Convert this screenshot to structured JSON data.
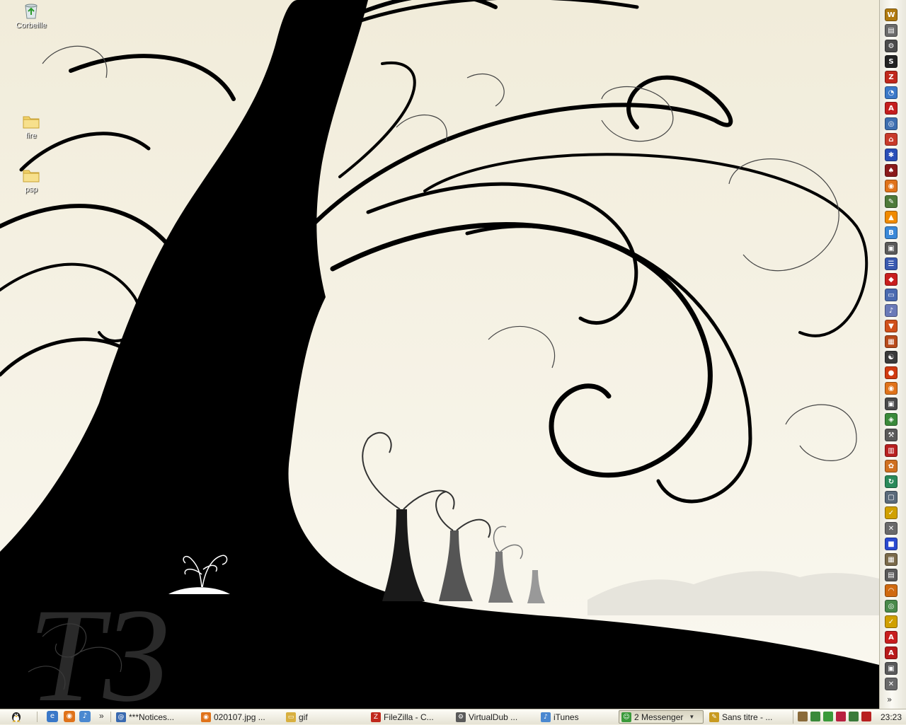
{
  "desktop": {
    "icons": [
      {
        "label": "Corbeille",
        "icon": "recycle-bin-icon"
      },
      {
        "label": "fire",
        "icon": "folder-icon"
      },
      {
        "label": "psp",
        "icon": "folder-icon"
      }
    ],
    "wallpaper_logo": "T3"
  },
  "sidebar": {
    "icons": [
      {
        "name": "wow-icon",
        "glyph": "W",
        "color": "#b07a10"
      },
      {
        "name": "toolbar-icon",
        "glyph": "▤",
        "color": "#6a6a6a"
      },
      {
        "name": "settings-icon",
        "glyph": "⚙",
        "color": "#4b4b4b"
      },
      {
        "name": "steam-icon",
        "glyph": "S",
        "color": "#222222"
      },
      {
        "name": "filezilla-icon",
        "glyph": "Z",
        "color": "#c0281c"
      },
      {
        "name": "messenger-icon",
        "glyph": "◔",
        "color": "#3a78c8"
      },
      {
        "name": "ati-icon",
        "glyph": "A",
        "color": "#c41e1e"
      },
      {
        "name": "globe-icon",
        "glyph": "◎",
        "color": "#3e6fb0"
      },
      {
        "name": "home-icon",
        "glyph": "⌂",
        "color": "#c83a2a"
      },
      {
        "name": "network-icon",
        "glyph": "✱",
        "color": "#2a4fb8"
      },
      {
        "name": "gamepad-icon",
        "glyph": "♠",
        "color": "#8a1a1a"
      },
      {
        "name": "firefox-icon",
        "glyph": "◉",
        "color": "#e0731a"
      },
      {
        "name": "editor-icon",
        "glyph": "✎",
        "color": "#4e7a3a"
      },
      {
        "name": "vlc-icon",
        "glyph": "▲",
        "color": "#f08a00"
      },
      {
        "name": "bs-icon",
        "glyph": "B",
        "color": "#3a88d8"
      },
      {
        "name": "monitor-icon",
        "glyph": "▣",
        "color": "#5a5a5a"
      },
      {
        "name": "document-icon",
        "glyph": "☰",
        "color": "#3a5ab0"
      },
      {
        "name": "adobe-icon",
        "glyph": "◆",
        "color": "#c81e1e"
      },
      {
        "name": "window-icon",
        "glyph": "▭",
        "color": "#4a6ab0"
      },
      {
        "name": "music-file-icon",
        "glyph": "♪",
        "color": "#6a7ab8"
      },
      {
        "name": "shield-icon",
        "glyph": "▼",
        "color": "#d0501a"
      },
      {
        "name": "grid-icon",
        "glyph": "▦",
        "color": "#b84a1a"
      },
      {
        "name": "runner-icon",
        "glyph": "☯",
        "color": "#3a3a3a"
      },
      {
        "name": "orb-icon",
        "glyph": "●",
        "color": "#d03a10"
      },
      {
        "name": "firefox2-icon",
        "glyph": "◉",
        "color": "#e0731a"
      },
      {
        "name": "tv-icon",
        "glyph": "▣",
        "color": "#4a4a4a"
      },
      {
        "name": "package-icon",
        "glyph": "◈",
        "color": "#3a8a3a"
      },
      {
        "name": "tool-icon",
        "glyph": "⚒",
        "color": "#5a5a5a"
      },
      {
        "name": "chart-icon",
        "glyph": "▥",
        "color": "#b82020"
      },
      {
        "name": "paint-icon",
        "glyph": "✿",
        "color": "#d07020"
      },
      {
        "name": "refresh-icon",
        "glyph": "↻",
        "color": "#2a8a5a"
      },
      {
        "name": "screen-icon",
        "glyph": "▢",
        "color": "#5a6a7a"
      },
      {
        "name": "norton-icon",
        "glyph": "✓",
        "color": "#d0a000"
      },
      {
        "name": "cross-tools-icon",
        "glyph": "✕",
        "color": "#6a6a6a"
      },
      {
        "name": "blue-square-icon",
        "glyph": "■",
        "color": "#2a4ad0"
      },
      {
        "name": "calendar-icon",
        "glyph": "▦",
        "color": "#7a6a4a"
      },
      {
        "name": "printer-icon",
        "glyph": "▤",
        "color": "#5a5a5a"
      },
      {
        "name": "headset-icon",
        "glyph": "◠",
        "color": "#d06a10"
      },
      {
        "name": "disc-icon",
        "glyph": "◎",
        "color": "#4a8a4a"
      },
      {
        "name": "norton2-icon",
        "glyph": "✓",
        "color": "#d0a000"
      },
      {
        "name": "pdf-icon",
        "glyph": "A",
        "color": "#c81e1e"
      },
      {
        "name": "pdf2-icon",
        "glyph": "A",
        "color": "#b81a1a"
      },
      {
        "name": "tv2-icon",
        "glyph": "▣",
        "color": "#5a5a5a"
      },
      {
        "name": "cross-tools2-icon",
        "glyph": "✕",
        "color": "#6a6a6a"
      }
    ],
    "more_label": "»"
  },
  "taskbar": {
    "start_icon": "tux-icon",
    "quick_launch": [
      {
        "name": "ie-icon",
        "glyph": "e",
        "color": "#3a78c8"
      },
      {
        "name": "firefox-icon",
        "glyph": "◉",
        "color": "#e0731a"
      },
      {
        "name": "itunes-icon",
        "glyph": "♪",
        "color": "#4a88d0"
      }
    ],
    "ql_more": "»",
    "buttons": [
      {
        "label": "***Notices...",
        "icon": "@",
        "color": "#3a6ab0",
        "active": false
      },
      {
        "label": "020107.jpg ...",
        "icon": "◉",
        "color": "#e0731a",
        "active": false
      },
      {
        "label": "gif",
        "icon": "▭",
        "color": "#d8b040",
        "active": false
      },
      {
        "label": "FileZilla - C...",
        "icon": "Z",
        "color": "#c0281c",
        "active": false
      },
      {
        "label": "VirtualDub ...",
        "icon": "⚙",
        "color": "#5a5a5a",
        "active": false
      },
      {
        "label": "iTunes",
        "icon": "♪",
        "color": "#4a88d0",
        "active": false
      },
      {
        "label": "2 Messenger",
        "icon": "☺",
        "color": "#3a9a3a",
        "active": true
      },
      {
        "label": "Sans titre - ...",
        "icon": "✎",
        "color": "#c89a20",
        "active": false
      }
    ],
    "tray_icons": [
      {
        "name": "tray-user-icon",
        "color": "#8a6a3a"
      },
      {
        "name": "tray-plant-icon",
        "color": "#3a8a3a"
      },
      {
        "name": "tray-people-icon",
        "color": "#3a9a3a"
      },
      {
        "name": "tray-security-icon",
        "color": "#b82040"
      },
      {
        "name": "tray-meter-icon",
        "color": "#3a7a3a"
      },
      {
        "name": "tray-speaker-icon",
        "color": "#b82020"
      }
    ],
    "clock": "23:23"
  }
}
